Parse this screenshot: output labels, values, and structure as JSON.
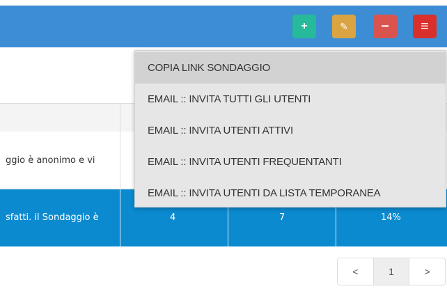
{
  "header": {
    "accent": "#3c8dd4",
    "buttons": [
      {
        "name": "add",
        "icon": "plus-icon",
        "glyph": "+",
        "color": "#26b99a"
      },
      {
        "name": "edit",
        "icon": "edit-icon",
        "glyph": "✎",
        "color": "#d9a441"
      },
      {
        "name": "remove",
        "icon": "minus-icon",
        "glyph": "−",
        "color": "#d9534f"
      },
      {
        "name": "menu",
        "icon": "menu-icon",
        "glyph": "≡",
        "color": "#d9302c"
      }
    ]
  },
  "dropdown": {
    "items": [
      {
        "label": "COPIA LINK SONDAGGIO"
      },
      {
        "label": "EMAIL :: INVITA TUTTI GLI UTENTI"
      },
      {
        "label": "EMAIL :: INVITA UTENTI ATTIVI"
      },
      {
        "label": "EMAIL :: INVITA UTENTI FREQUENTANTI"
      },
      {
        "label": "EMAIL :: INVITA UTENTI DA LISTA TEMPORANEA"
      }
    ]
  },
  "table": {
    "rows": [
      {
        "text": "ggio è anonimo e vi",
        "values": []
      },
      {
        "text": "sfatti. il Sondaggio è",
        "values": [
          "4",
          "7",
          "14%"
        ],
        "highlight_color": "#0b8ad0"
      }
    ]
  },
  "pagination": {
    "prev": "<",
    "page": "1",
    "next": ">"
  }
}
